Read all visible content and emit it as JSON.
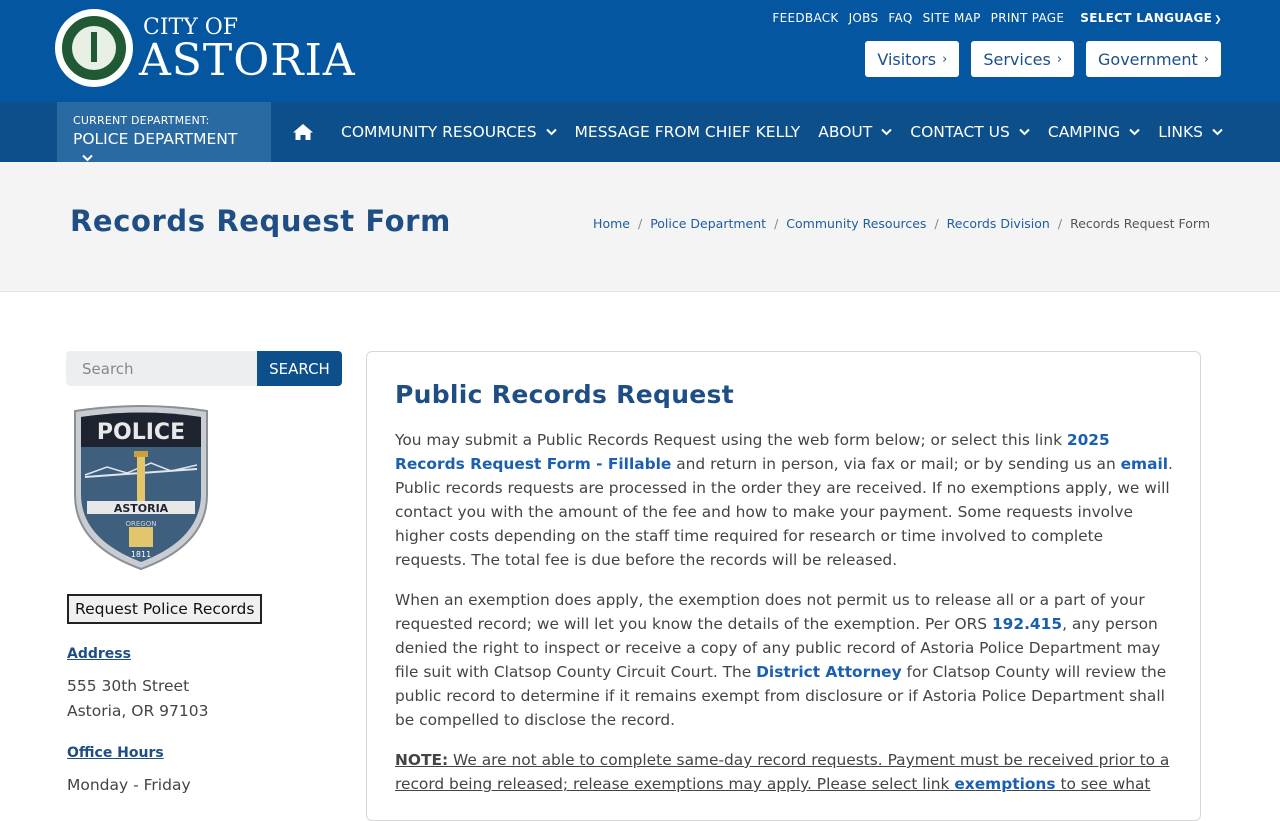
{
  "header": {
    "logo": {
      "city_of": "CITY OF",
      "name": "ASTORIA",
      "seal_text_top": "ASTORIA",
      "seal_text_bottom": "OREGON"
    },
    "utility_links": [
      "FEEDBACK",
      "JOBS",
      "FAQ",
      "SITE MAP",
      "PRINT PAGE"
    ],
    "language_label": "SELECT LANGUAGE",
    "quick_buttons": [
      "Visitors",
      "Services",
      "Government"
    ]
  },
  "nav": {
    "department_label": "CURRENT DEPARTMENT:",
    "department_name": "POLICE DEPARTMENT",
    "items": [
      "COMMUNITY RESOURCES",
      "MESSAGE FROM CHIEF KELLY",
      "ABOUT",
      "CONTACT US",
      "CAMPING",
      "LINKS"
    ]
  },
  "title_band": {
    "title": "Records Request Form",
    "breadcrumb": [
      "Home",
      "Police Department",
      "Community Resources",
      "Records Division",
      "Records Request Form"
    ]
  },
  "sidebar": {
    "search_placeholder": "Search",
    "search_button": "SEARCH",
    "badge": {
      "top": "POLICE",
      "banner": "ASTORIA",
      "state": "OREGON",
      "year": "1811"
    },
    "request_button": "Request Police Records",
    "address_heading": "Address",
    "address_line1": "555 30th Street",
    "address_line2": "Astoria, OR 97103",
    "hours_heading": "Office Hours",
    "hours_line1": "Monday - Friday"
  },
  "main": {
    "card_title": "Public Records Request",
    "p1": {
      "t1": "You may submit a Public Records Request using the web form below; or select this link ",
      "link1": "2025 Records Request Form - Fillable",
      "t2": " and return in person, via fax or mail; or by sending us an ",
      "link2": "email",
      "t3": ". Public records requests are processed in the order they are received. If no exemptions apply, we will contact you with the amount of the fee and how to make your payment. Some requests involve higher costs depending on the staff time required for research or time involved to complete requests. The total fee is due before the records will be released."
    },
    "p2": {
      "t1": "When an exemption does apply, the exemption does not permit us to release all or a part of your requested record; we will let you know the details of the exemption. Per ORS ",
      "link1": "192.415",
      "t2": ", any person denied the right to inspect or receive a copy of any public record of Astoria Police Department may file suit with Clatsop County Circuit Court. The ",
      "link2": "District Attorney",
      "t3": " for Clatsop County will review the public record to determine if it remains exempt from disclosure or if Astoria Police Department shall be compelled to disclose the record."
    },
    "p3": {
      "label": "NOTE:",
      "t1": " We are not able to complete same-day record requests. Payment must be received prior to a record being released; release exemptions may apply. Please select link ",
      "link1": "exemptions",
      "t2": " to see what"
    }
  },
  "colors": {
    "header_blue": "#03569f",
    "nav_blue": "#0d4f8a",
    "dept_blue": "#2a6aa3",
    "title_blue": "#1f4e85",
    "link_blue": "#1b5fb0"
  }
}
